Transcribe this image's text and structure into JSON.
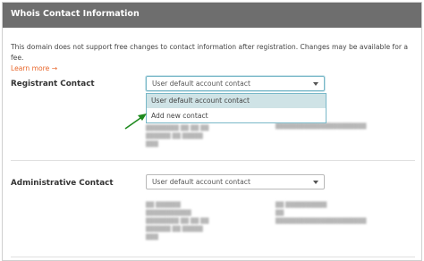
{
  "header": {
    "title": "Whois Contact Information"
  },
  "notice": {
    "text": "This domain does not support free changes to contact information after registration. Changes may be available for a fee.",
    "link_label": "Learn more →"
  },
  "registrant": {
    "label": "Registrant Contact",
    "select_value": "User default account contact",
    "dropdown_options": [
      "User default account contact",
      "Add new contact"
    ]
  },
  "administrative": {
    "label": "Administrative Contact",
    "select_value": "User default account contact"
  },
  "colors": {
    "header_bg": "#6e6e6e",
    "link": "#e8662a",
    "highlight": "#cfe3e6",
    "arrow": "#1e8a1e"
  }
}
